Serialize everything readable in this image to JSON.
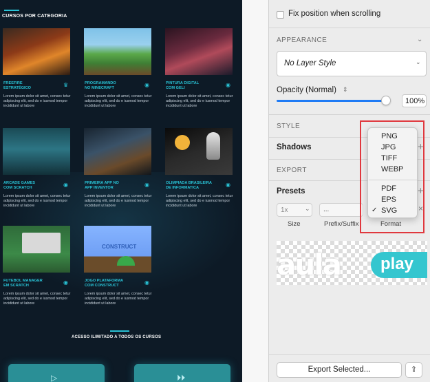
{
  "canvas": {
    "category_title": "CURSOS POR CATEGORIA",
    "cards": [
      {
        "title": "FREEFIRE\nESTRATÉGICO",
        "icon": "trophy-icon",
        "desc": "Lorem ipsum dolor sit amet, consec tetur adipiscing elit, sed do e iusmod tempor incididunt ut labore"
      },
      {
        "title": "PROGRAMANDO\nNO MINECRAFT",
        "icon": "gamepad-icon",
        "desc": "Lorem ipsum dolor sit amet, consec tetur adipiscing elit, sed do e iusmod tempor incididunt ut labore"
      },
      {
        "title": "PINTURA DIGITAL\nCOM GELI",
        "icon": "gamepad-icon",
        "desc": "Lorem ipsum dolor sit amet, consec tetur adipiscing elit, sed do e iusmod tempor incididunt ut labore"
      },
      {
        "title": "ARCADE GAMES\nCOM SCRATCH",
        "icon": "gamepad-icon",
        "desc": "Lorem ipsum dolor sit amet, consec tetur adipiscing elit, sed do e iusmod tempor incididunt ut labore"
      },
      {
        "title": "PRIMEIRA APP NO\nAPP INVENTOR",
        "icon": "gamepad-icon",
        "desc": "Lorem ipsum dolor sit amet, consec tetur adipiscing elit, sed do e iusmod tempor incididunt ut labore"
      },
      {
        "title": "OLIMPIADA BRASILEIRA\nDE INFORMATICA",
        "icon": "gamepad-icon",
        "desc": "Lorem ipsum dolor sit amet, consec tetur adipiscing elit, sed do e iusmod tempor incididunt ut labore"
      },
      {
        "title": "FUTEBOL MANAGER\nEM SCRATCH",
        "icon": "gamepad-icon",
        "desc": "Lorem ipsum dolor sit amet, consec tetur adipiscing elit, sed do e iusmod tempor incididunt ut labore"
      },
      {
        "title": "JOGO PLATAFORMA\nCOM CONSTRUCT",
        "icon": "gamepad-icon",
        "desc": "Lorem ipsum dolor sit amet, consec tetur adipiscing elit, sed do e iusmod tempor incididunt ut labore"
      }
    ],
    "thumb_construct_text": "CONSTRUCT",
    "cta": "ACESSO ILIMITADO A TODOS OS CURSOS"
  },
  "inspector": {
    "fix_position": "Fix position when scrolling",
    "appearance": "APPEARANCE",
    "layer_style": "No Layer Style",
    "opacity_label": "Opacity (Normal)",
    "opacity_value": "100%",
    "opacity_fraction": 1.0,
    "style": "STYLE",
    "shadows": "Shadows",
    "export": "EXPORT",
    "presets": "Presets",
    "size_value": "1x",
    "prefix_value": "...",
    "size_label": "Size",
    "prefix_label": "Prefix/Suffix",
    "format_label": "Format",
    "format_options": [
      "PNG",
      "JPG",
      "TIFF",
      "WEBP",
      "PDF",
      "EPS",
      "SVG"
    ],
    "format_selected": "SVG",
    "preview_logo_a": "aula",
    "preview_logo_play": "play",
    "export_button": "Export Selected...",
    "accent_color": "#1f7bf5",
    "highlight_color": "#e0383e"
  }
}
